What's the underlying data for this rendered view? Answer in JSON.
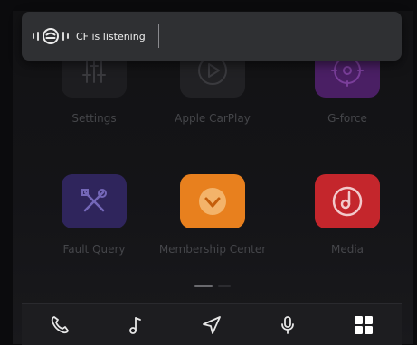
{
  "voice_assistant": {
    "status_text": "CF is listening"
  },
  "apps": [
    {
      "label": "Settings"
    },
    {
      "label": "Apple CarPlay"
    },
    {
      "label": "G-force"
    },
    {
      "label": "Fault Query"
    },
    {
      "label": "Membership Center"
    },
    {
      "label": "Media"
    }
  ],
  "dock": {
    "items": [
      "phone-icon",
      "music-note-icon",
      "navigation-icon",
      "microphone-icon",
      "app-grid-icon"
    ]
  },
  "colors": {
    "voice_bar_bg": "#2f3033",
    "label_text": "#45464a",
    "settings_tile": "#1d1d20",
    "carplay_tile": "#212124",
    "gforce_tile": "#4a1f64",
    "fault_tile": "#2f255c",
    "membership_tile": "#e8801e",
    "media_tile": "#c4262c"
  }
}
